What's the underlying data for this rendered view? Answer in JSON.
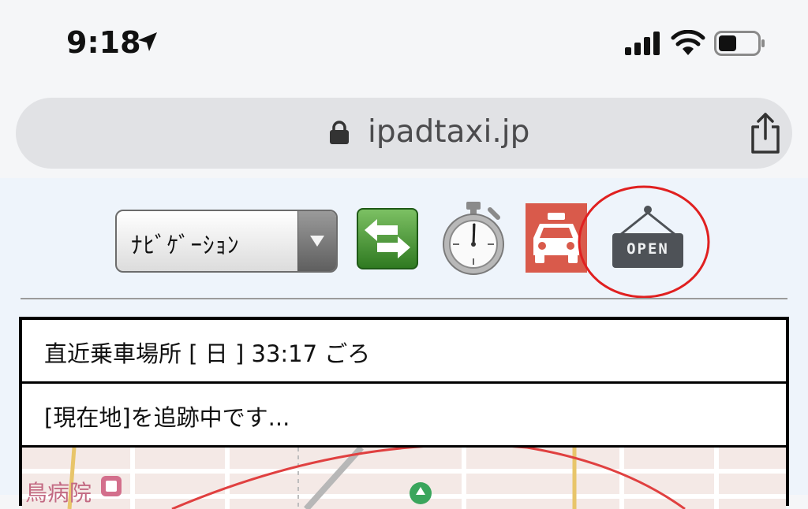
{
  "status_bar": {
    "time": "9:18",
    "icons": [
      "location-arrow-icon",
      "cellular-signal-icon",
      "wifi-icon",
      "battery-icon"
    ]
  },
  "browser": {
    "url": "ipadtaxi.jp",
    "icons": [
      "lock-icon",
      "share-icon"
    ]
  },
  "toolbar": {
    "nav_select_value": "ﾅﾋﾞｹﾞｰｼｮﾝ",
    "buttons": [
      "swap-arrows-icon",
      "stopwatch-icon",
      "taxi-icon",
      "open-sign-icon"
    ],
    "open_sign_text": "OPEN",
    "highlight_color": "#e02020"
  },
  "info": {
    "nearest_pickup": "直近乗車場所 [ 日 ] 33:17 ごろ",
    "tracking_status": "[現在地]を追跡中です..."
  },
  "map": {
    "label": "鳥病院"
  },
  "colors": {
    "taxi_bg": "#d95a4b",
    "swap_green": "#3f8a2e",
    "page_bg": "#eef4fb"
  }
}
